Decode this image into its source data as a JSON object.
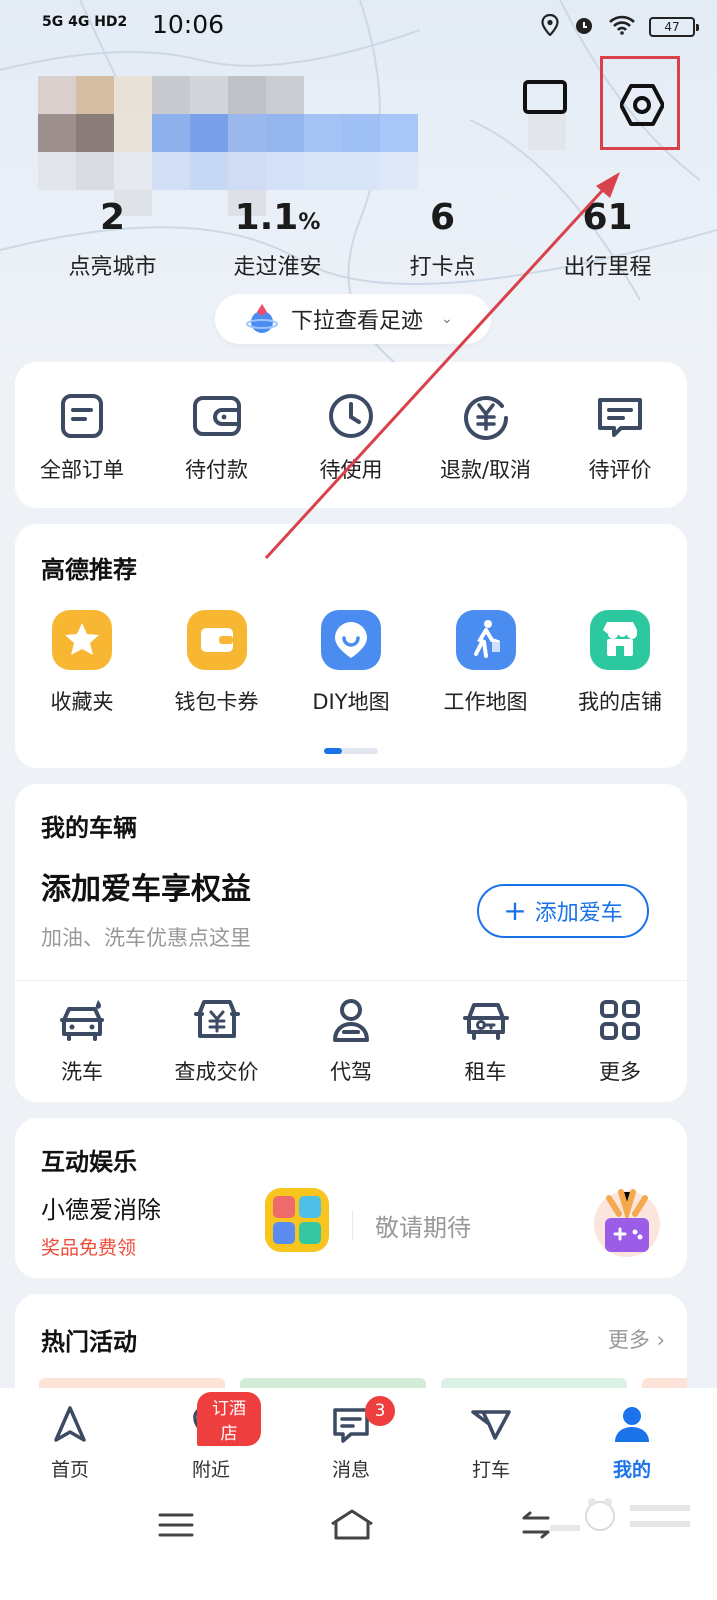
{
  "status_bar": {
    "network": "5G 4G HD2",
    "time": "10:06",
    "battery": "47"
  },
  "stats": [
    {
      "value": "2",
      "unit": "",
      "label": "点亮城市"
    },
    {
      "value": "1.1",
      "unit": "%",
      "label": "走过淮安"
    },
    {
      "value": "6",
      "unit": "",
      "label": "打卡点"
    },
    {
      "value": "61",
      "unit": "",
      "label": "出行里程"
    }
  ],
  "footprint_pill": "下拉查看足迹",
  "orders": [
    {
      "label": "全部订单",
      "icon": "order-list-icon"
    },
    {
      "label": "待付款",
      "icon": "wallet-icon"
    },
    {
      "label": "待使用",
      "icon": "clock-icon"
    },
    {
      "label": "退款/取消",
      "icon": "refund-icon"
    },
    {
      "label": "待评价",
      "icon": "comment-icon"
    }
  ],
  "recommend": {
    "title": "高德推荐",
    "items": [
      {
        "label": "收藏夹",
        "icon": "star-icon",
        "color": "#f7b733"
      },
      {
        "label": "钱包卡券",
        "icon": "wallet-card-icon",
        "color": "#f7b733"
      },
      {
        "label": "DIY地图",
        "icon": "diy-map-icon",
        "color": "#4a8cf0"
      },
      {
        "label": "工作地图",
        "icon": "walker-icon",
        "color": "#4a8cf0"
      },
      {
        "label": "我的店铺",
        "icon": "shop-icon",
        "color": "#2cc9a0"
      }
    ]
  },
  "vehicle": {
    "title": "我的车辆",
    "headline": "添加爱车享权益",
    "sub": "加油、洗车优惠点这里",
    "add_button": "添加爱车",
    "items": [
      {
        "label": "洗车",
        "icon": "car-wash-icon"
      },
      {
        "label": "查成交价",
        "icon": "car-price-icon"
      },
      {
        "label": "代驾",
        "icon": "driver-icon"
      },
      {
        "label": "租车",
        "icon": "car-rent-icon"
      },
      {
        "label": "更多",
        "icon": "more-grid-icon"
      }
    ]
  },
  "entertainment": {
    "title": "互动娱乐",
    "game_name": "小德爱消除",
    "game_sub": "奖品免费领",
    "coming": "敬请期待"
  },
  "hot": {
    "title": "热门活动",
    "more": "更多"
  },
  "tabs": [
    {
      "label": "首页",
      "icon": "navigate-icon"
    },
    {
      "label": "附近",
      "icon": "heart-pin-icon",
      "badge": "订酒店"
    },
    {
      "label": "消息",
      "icon": "message-icon",
      "badge": "3"
    },
    {
      "label": "打车",
      "icon": "taxi-icon"
    },
    {
      "label": "我的",
      "icon": "user-icon",
      "active": true
    }
  ],
  "colors": {
    "accent": "#1a73e8",
    "highlight_box": "#d9414b",
    "badge": "#ee3e3e",
    "promo_text": "#ee4d3b"
  }
}
